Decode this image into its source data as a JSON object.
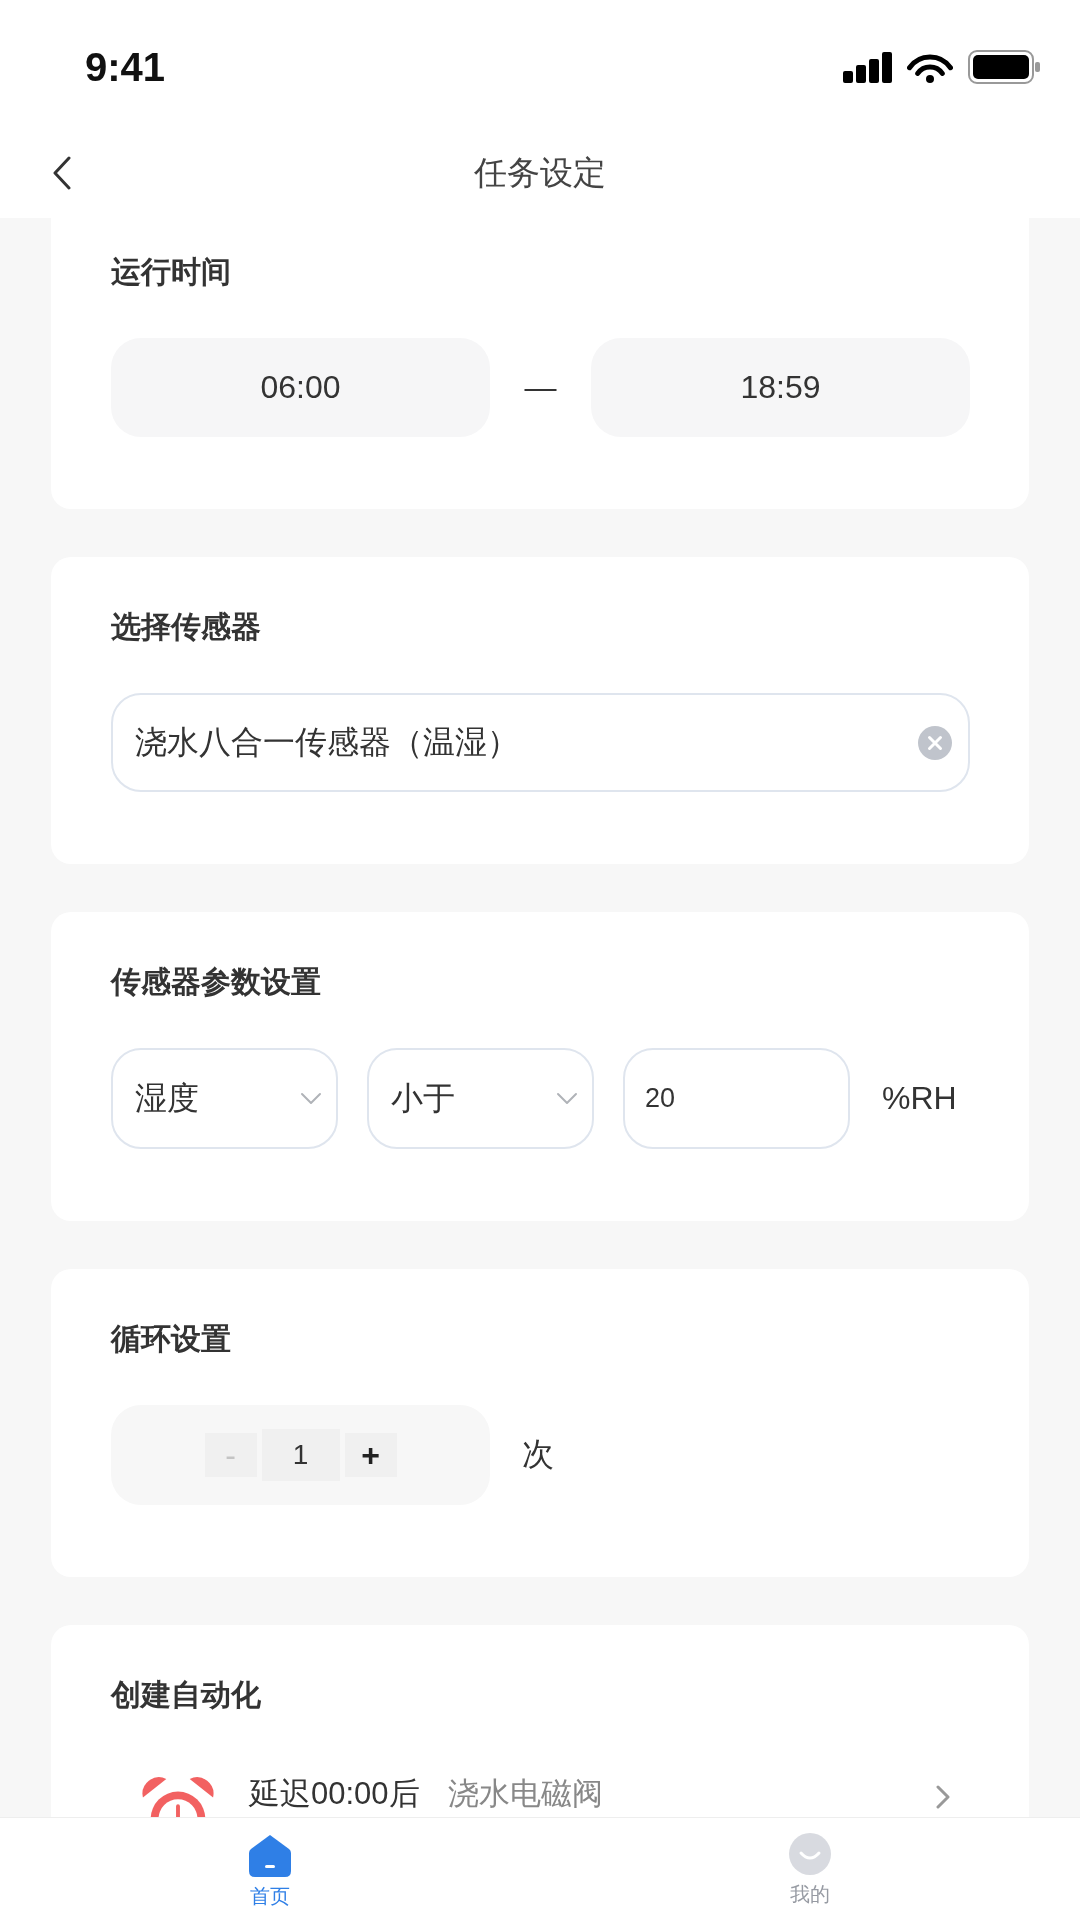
{
  "status_bar": {
    "time": "9:41"
  },
  "header": {
    "title": "任务设定"
  },
  "sections": [
    {
      "kind": "time_range",
      "title": "运行时间",
      "start": "06:00",
      "separator": "—",
      "end": "18:59"
    },
    {
      "kind": "sensor",
      "title": "选择传感器",
      "value": "浇水八合一传感器（温湿）"
    },
    {
      "kind": "condition",
      "title": "传感器参数设置",
      "parameter": "湿度",
      "operator": "小于",
      "threshold": "20",
      "unit": "%RH"
    },
    {
      "kind": "loop",
      "title": "循环设置",
      "stepper": {
        "decrement": {
          "label": "-",
          "disabled": true
        },
        "value": "1",
        "increment": {
          "label": "+",
          "disabled": false
        }
      },
      "unit": "次"
    },
    {
      "kind": "automation",
      "title": "创建自动化",
      "actions": [
        {
          "delay": "延迟00:00后",
          "device": "浇水电磁阀"
        }
      ]
    }
  ],
  "tab_bar": [
    {
      "label": "首页",
      "selected": true
    },
    {
      "label": "我的",
      "selected": false
    }
  ]
}
